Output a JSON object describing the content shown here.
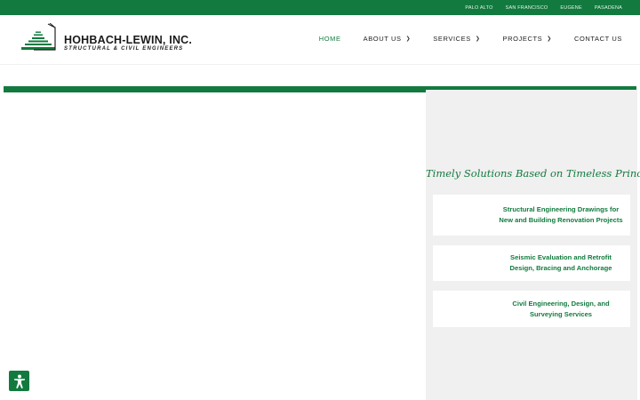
{
  "topbar": {
    "locations": [
      "PALO ALTO",
      "SAN FRANCISCO",
      "EUGENE",
      "PASADENA"
    ]
  },
  "brand": {
    "name": "HOHBACH-LEWIN, INC.",
    "tagline": "STRUCTURAL & CIVIL ENGINEERS"
  },
  "nav": {
    "home": "HOME",
    "about": "ABOUT US",
    "services": "SERVICES",
    "projects": "PROJECTS",
    "contact": "CONTACT US"
  },
  "hero": {
    "tagline": "Timely Solutions Based on Timeless Principles"
  },
  "cards": [
    {
      "text": "Structural Engineering Drawings for New and Building Renovation Projects"
    },
    {
      "text": "Seismic Evaluation and Retrofit Design, Bracing and Anchorage"
    },
    {
      "text": "Civil Engineering, Design, and Surveying Services"
    }
  ],
  "colors": {
    "brand_green": "#127a3e",
    "panel_gray": "#f0f0f0"
  },
  "icons": {
    "chevron": "chevron-down-icon",
    "accessibility": "accessibility-icon"
  }
}
